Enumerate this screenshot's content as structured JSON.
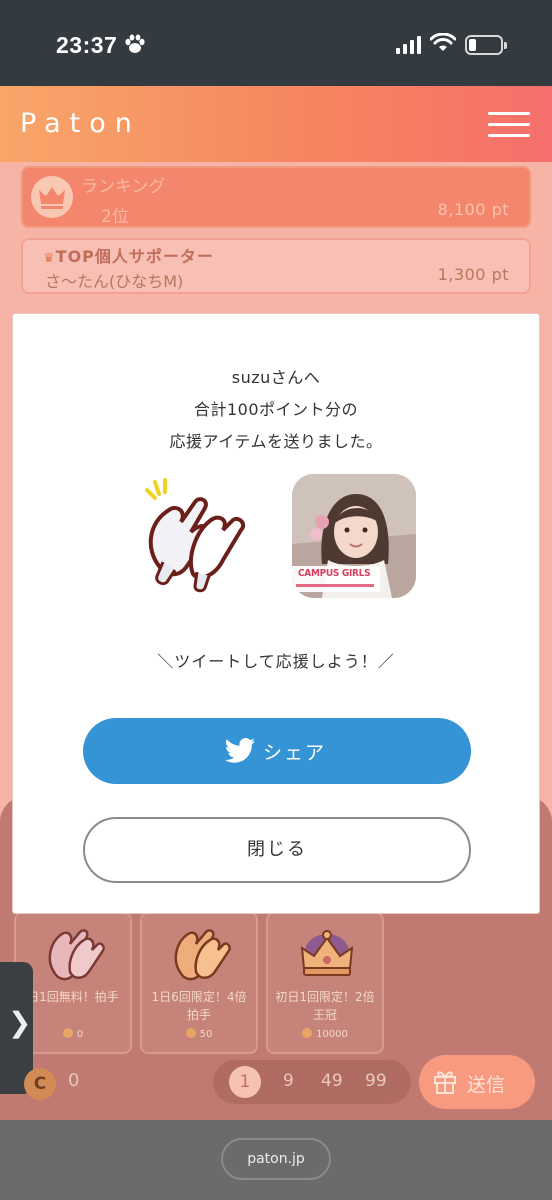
{
  "status_bar": {
    "time": "23:37",
    "icons": [
      "paw-icon",
      "signal-icon",
      "wifi-icon",
      "battery-icon"
    ],
    "battery_level": 0.2
  },
  "header": {
    "logo": "Paton",
    "menu_icon": "hamburger-menu-icon",
    "gradient": [
      "#f8a66a",
      "#f56f6c"
    ]
  },
  "ranking": {
    "title": "ランキング",
    "rank": "2位",
    "points": "8,100 pt"
  },
  "top_supporter": {
    "title": "TOP個人サポーター",
    "name": "さ〜たん(ひなちM)",
    "points": "1,300 pt"
  },
  "items": [
    {
      "label": "日1回無料！拍手",
      "price": "0",
      "icon": "clap-icon"
    },
    {
      "label": "1日6回限定！4倍拍手",
      "price": "50",
      "icon": "clap-icon"
    },
    {
      "label": "初日1回限定！2倍王冠",
      "price": "10000",
      "icon": "crown-icon"
    }
  ],
  "balance": {
    "coin_letter": "C",
    "value": "0"
  },
  "quantity": {
    "options": [
      "1",
      "9",
      "49",
      "99"
    ],
    "selected": "1"
  },
  "send_button": "送信",
  "side_tab_glyph": "❯",
  "url": "paton.jp",
  "modal": {
    "line1": "suzuさんへ",
    "line2": "合計100ポイント分の",
    "line3": "応援アイテムを送りました。",
    "photo_caption": "CAMPUS GIRLS",
    "tweet_prompt": "＼ツイートして応援しよう！／",
    "share_label": "シェア",
    "close_label": "閉じる"
  },
  "colors": {
    "accent_orange": "#f6865e",
    "twitter_blue": "#3594d6",
    "status_bar": "#333a40"
  }
}
